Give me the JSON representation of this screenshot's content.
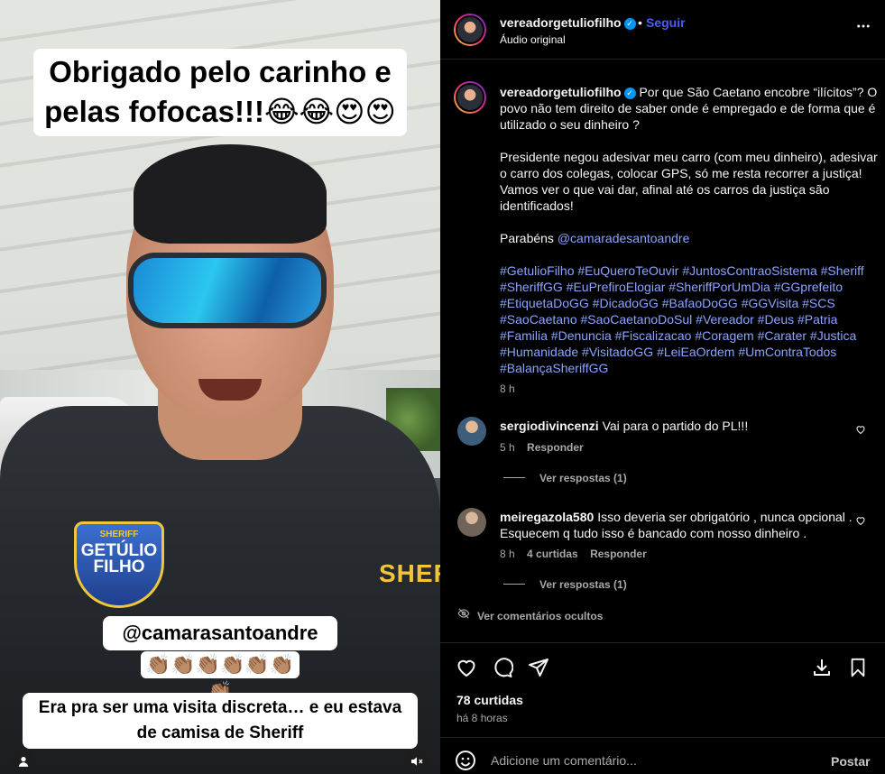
{
  "video": {
    "caption_top": "Obrigado pelo carinho e pelas fofocas!!!😂😂😍😍",
    "badge_line1": "SHERIFF",
    "badge_line2": "GETÚLIO FILHO",
    "shirt_text": "SHERI",
    "caption_mid": "@camarasantoandre",
    "caption_claps": "👏🏽👏🏽👏🏽👏🏽👏🏽👏🏽👏🏽",
    "caption_bottom_1": "Era pra ser uma visita discreta… e eu estava",
    "caption_bottom_2": "de camisa de Sheriff",
    "user_tag_icon": "user-icon",
    "mute_icon": "muted-speaker-icon"
  },
  "header": {
    "username": "vereadorgetuliofilho",
    "verified": "✓",
    "dot": "•",
    "follow_label": "Seguir",
    "audio_label": "Áudio original",
    "more_icon": "more-horizontal-icon"
  },
  "caption": {
    "username": "vereadorgetuliofilho",
    "lines": [
      "Por que São Caetano encobre “ilícitos”? O povo não tem direito de saber onde é empregado e de forma que é utilizado o seu dinheiro ?",
      "Presidente negou adesivar meu carro (com meu dinheiro), adesivar o carro dos colegas, colocar GPS, só me resta recorrer a justiça! Vamos ver o que vai dar, afinal até os carros da justiça são identificados!",
      "Parabéns"
    ],
    "mention": "@camaradesantoandre",
    "hashtags": "#GetulioFilho #EuQueroTeOuvir #JuntosContraoSistema #Sheriff #SheriffGG #EuPrefiroElogiar #SheriffPorUmDia #GGprefeito #EtiquetaDoGG #DicadoGG #BafaoDoGG #GGVisita #SCS #SaoCaetano #SaoCaetanoDoSul #Vereador #Deus #Patria #Familia #Denuncia #Fiscalizacao #Coragem #Carater #Justica #Humanidade #VisitadoGG #LeiEaOrdem #UmContraTodos #BalançaSheriffGG",
    "time": "8 h"
  },
  "comments": [
    {
      "username": "sergiodivincenzi",
      "text": "Vai para o partido do PL!!!",
      "time": "5 h",
      "likes": "",
      "reply": "Responder",
      "view_replies": "Ver respostas (1)"
    },
    {
      "username": "meiregazola580",
      "text": "Isso deveria ser obrigatório , nunca opcional . Esquecem q tudo isso é bancado com nosso dinheiro .",
      "time": "8 h",
      "likes": "4 curtidas",
      "reply": "Responder",
      "view_replies": "Ver respostas (1)"
    }
  ],
  "hidden_comments_label": "Ver comentários ocultos",
  "actions": {
    "like_icon": "heart-icon",
    "comment_icon": "comment-icon",
    "share_icon": "send-icon",
    "download_icon": "download-icon",
    "save_icon": "bookmark-icon"
  },
  "likes_label": "78 curtidas",
  "posted_label": "há 8 horas",
  "comment_bar": {
    "emoji_icon": "emoji-icon",
    "placeholder": "Adicione um comentário...",
    "post_label": "Postar"
  }
}
